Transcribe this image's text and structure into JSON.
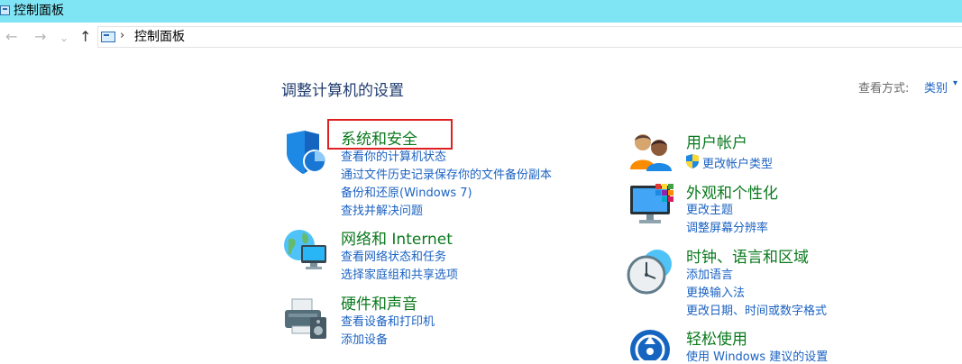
{
  "window": {
    "title": "控制面板"
  },
  "nav": {
    "back": "←",
    "forward": "→",
    "recent": "⌄",
    "up": "↑",
    "breadcrumb_sep": "›",
    "breadcrumb": "控制面板"
  },
  "main": {
    "heading": "调整计算机的设置",
    "view_by_label": "查看方式:",
    "view_by_value": "类别",
    "view_by_caret": "▾"
  },
  "categories_left": [
    {
      "title": "系统和安全",
      "icon": "security-shield-icon",
      "links": [
        "查看你的计算机状态",
        "通过文件历史记录保存你的文件备份副本",
        "备份和还原(Windows 7)",
        "查找并解决问题"
      ]
    },
    {
      "title": "网络和 Internet",
      "icon": "network-globe-icon",
      "links": [
        "查看网络状态和任务",
        "选择家庭组和共享选项"
      ]
    },
    {
      "title": "硬件和声音",
      "icon": "printer-speaker-icon",
      "links": [
        "查看设备和打印机",
        "添加设备"
      ]
    }
  ],
  "categories_right": [
    {
      "title": "用户帐户",
      "icon": "users-icon",
      "links": [
        "更改帐户类型"
      ]
    },
    {
      "title": "外观和个性化",
      "icon": "monitor-palette-icon",
      "links": [
        "更改主题",
        "调整屏幕分辨率"
      ]
    },
    {
      "title": "时钟、语言和区域",
      "icon": "clock-globe-icon",
      "links": [
        "添加语言",
        "更换输入法",
        "更改日期、时间或数字格式"
      ]
    },
    {
      "title": "轻松使用",
      "icon": "ease-of-access-icon",
      "links": [
        "使用 Windows 建议的设置"
      ]
    }
  ],
  "colors": {
    "titlebar": "#7fe5f5",
    "category_title": "#0b7a1e",
    "link": "#1b62c2",
    "highlight_box": "#e02020"
  }
}
